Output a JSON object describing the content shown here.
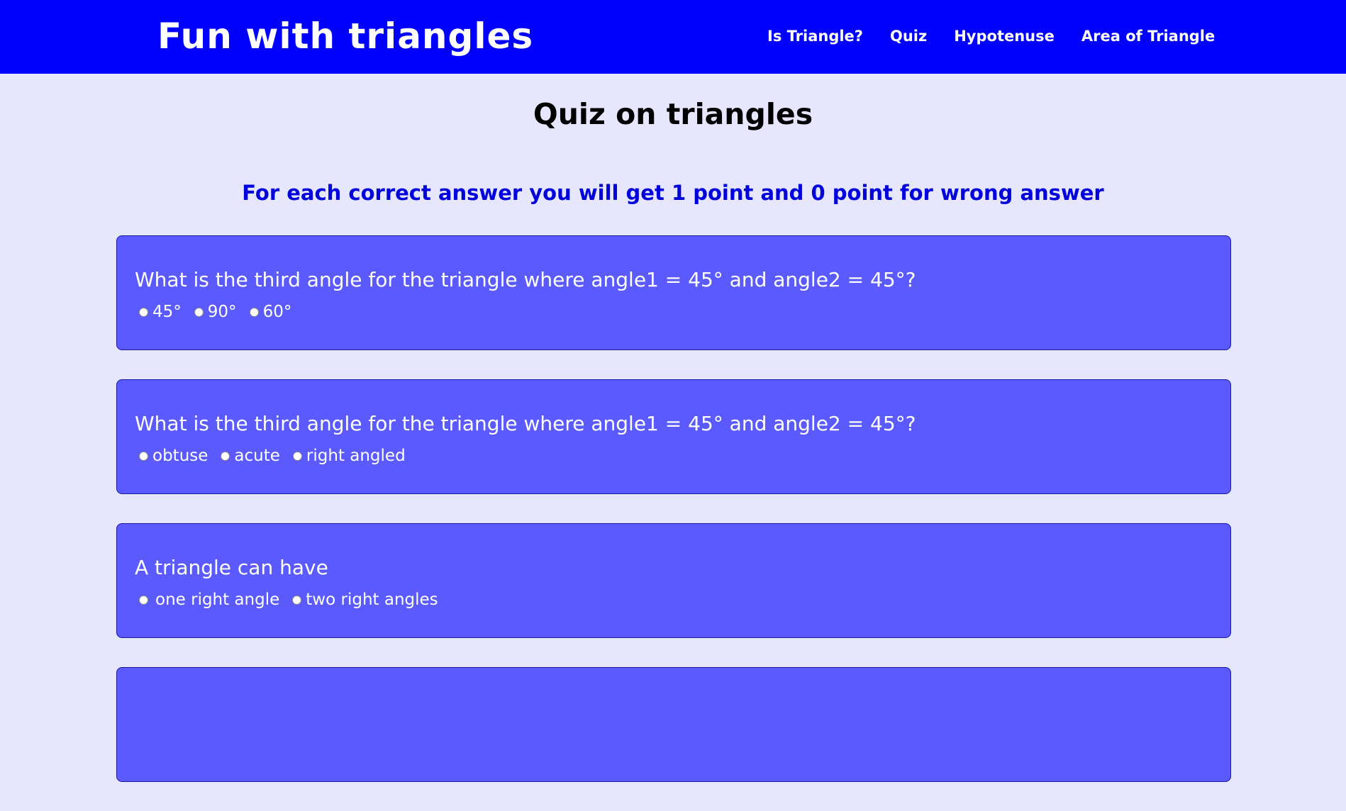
{
  "header": {
    "brand": "Fun with triangles",
    "nav": [
      {
        "label": "Is Triangle?"
      },
      {
        "label": "Quiz"
      },
      {
        "label": "Hypotenuse"
      },
      {
        "label": "Area of Triangle"
      }
    ]
  },
  "main": {
    "title": "Quiz on triangles",
    "scoring_note": "For each correct answer you will get 1 point and 0 point for wrong answer",
    "questions": [
      {
        "text": "What is the third angle for the triangle where angle1 = 45° and angle2 = 45°?",
        "options": [
          "45°",
          "90°",
          "60°"
        ]
      },
      {
        "text": "What is the third angle for the triangle where angle1 = 45° and angle2 = 45°?",
        "options": [
          "obtuse",
          "acute",
          "right angled"
        ]
      },
      {
        "text": "A triangle can have",
        "options": [
          "one right angle",
          "two right angles"
        ]
      }
    ]
  },
  "colors": {
    "header_bg": "#0000ff",
    "page_bg": "#e6e6ff",
    "card_bg": "#5a5aff",
    "scoring_note": "#0000dd"
  },
  "icons": {
    "radio": "radio-button-icon"
  }
}
